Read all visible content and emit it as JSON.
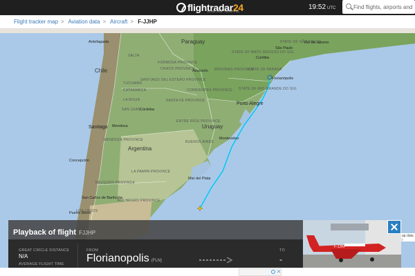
{
  "header": {
    "logo_text_a": "flightradar",
    "logo_text_b": "24",
    "logo_sub": "LIVE AIR TRAFFIC",
    "time": "19:52",
    "timezone": "UTC",
    "search_placeholder": "Find flights, airports and more"
  },
  "breadcrumb": {
    "items": [
      "Flight tracker map",
      "Aviation data",
      "Aircraft"
    ],
    "current": "F-JJHP"
  },
  "map": {
    "countries": [
      "Paraguay",
      "Chile",
      "Argentina",
      "Uruguay"
    ],
    "regions": [
      "State of Mato Grosso do Sul",
      "State of São Paulo",
      "Chaco Province",
      "Formosa Province",
      "Santiago del Estero Province",
      "Salta",
      "Tucumán",
      "Catamarca",
      "Misiones Province",
      "State of Paraná",
      "State of Rio Grande do Sul",
      "La Rioja",
      "San Juan",
      "Córdoba",
      "Santa Fe Province",
      "Corrientes Province",
      "Entre Ríos Province",
      "Mendoza Province",
      "Buenos Aires",
      "La Pampa Province",
      "Neuquén Province",
      "Río Negro Province",
      "Los Lagos",
      "Puerto Montt"
    ],
    "cities": [
      "São Paulo",
      "Rio de Janeiro",
      "Curitiba",
      "Florianópolis",
      "Porto Alegre",
      "Antofagasta",
      "Santiago",
      "Mendoza",
      "Concepción",
      "San Carlos de Bariloche",
      "Mar del Plata",
      "Montevideo",
      "Asunción"
    ],
    "route_color": "#00c9f4"
  },
  "playback": {
    "title": "Playback of flight",
    "registration": "FJJHP",
    "great_circle_label": "GREAT CIRCLE DISTANCE",
    "great_circle_value": "N/A",
    "avg_time_label": "AVERAGE FLIGHT TIME",
    "from_label": "FROM",
    "from_city": "Florianopolis",
    "from_code": "(FLN)",
    "to_label": "TO",
    "to_value": "-"
  },
  "photo": {
    "registration_text": "F-JJHP",
    "side_text": "ap data i"
  }
}
